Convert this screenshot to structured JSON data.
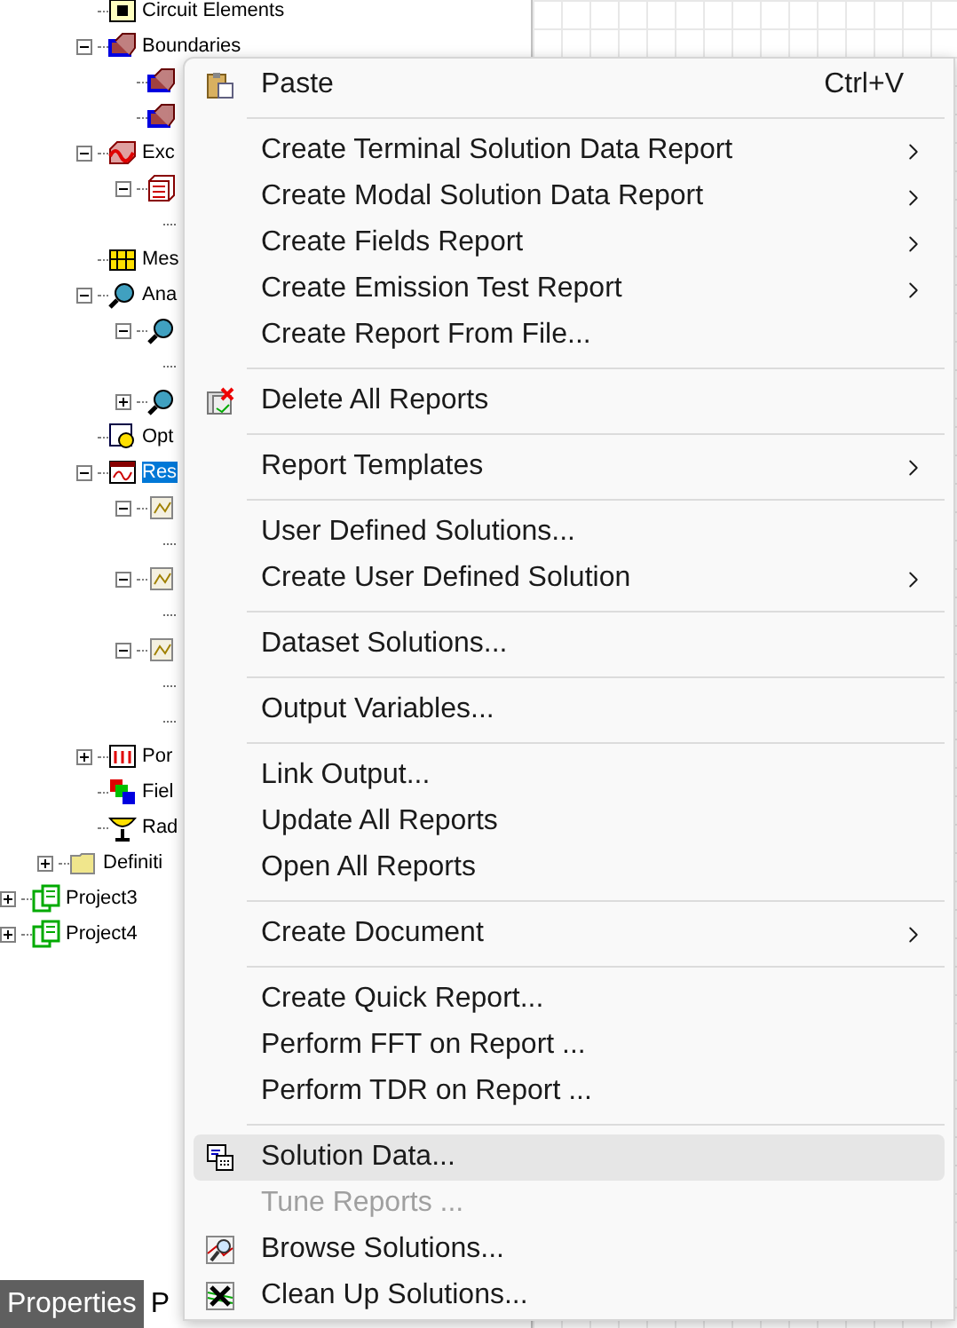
{
  "tree": [
    {
      "label": "Circuit Elements",
      "kind": "circuit"
    },
    {
      "label": "Boundaries",
      "kind": "boundary",
      "expanded": true,
      "children": [
        {
          "kind": "boundary"
        },
        {
          "kind": "boundary"
        }
      ]
    },
    {
      "label": "Exc",
      "kind": "excitation",
      "expanded": true,
      "children": [
        {
          "kind": "port",
          "expanded": true,
          "children": [
            {
              "kind": "connector"
            }
          ]
        }
      ]
    },
    {
      "label": "Mes",
      "kind": "mesh"
    },
    {
      "label": "Ana",
      "kind": "analysis",
      "expanded": true,
      "children": [
        {
          "kind": "analysis",
          "expanded": true,
          "children": [
            {
              "kind": "connector"
            }
          ]
        },
        {
          "kind": "analysis",
          "expanded": false
        }
      ]
    },
    {
      "label": "Opt",
      "kind": "optimetrics"
    },
    {
      "label": "Res",
      "kind": "results",
      "selected": true,
      "expanded": true,
      "children": [
        {
          "kind": "report",
          "expanded": true,
          "children": [
            {
              "kind": "connector"
            }
          ]
        },
        {
          "kind": "report",
          "expanded": true,
          "children": [
            {
              "kind": "connector"
            }
          ]
        },
        {
          "kind": "report",
          "expanded": true,
          "children": [
            {
              "kind": "connector"
            },
            {
              "kind": "connector"
            }
          ]
        }
      ]
    },
    {
      "label": "Por",
      "kind": "portfield",
      "expanded": false
    },
    {
      "label": "Fiel",
      "kind": "fields"
    },
    {
      "label": "Rad",
      "kind": "radiation"
    }
  ],
  "definitions": {
    "label": "Definiti",
    "kind": "folder",
    "expanded": false
  },
  "projects": [
    {
      "label": "Project3",
      "kind": "project",
      "expanded": false
    },
    {
      "label": "Project4",
      "kind": "project",
      "expanded": false
    }
  ],
  "bottom_tabs": [
    {
      "label": "Properties",
      "selected": true
    },
    {
      "label": "P",
      "selected": false
    }
  ],
  "menu": [
    {
      "kind": "paste",
      "label": "Paste",
      "shortcut": "Ctrl+V"
    },
    {
      "kind": "separator"
    },
    {
      "kind": "item",
      "label": "Create Terminal Solution Data Report",
      "submenu": true
    },
    {
      "kind": "item",
      "label": "Create Modal Solution Data Report",
      "submenu": true
    },
    {
      "kind": "item",
      "label": "Create Fields Report",
      "submenu": true
    },
    {
      "kind": "item",
      "label": "Create Emission Test Report",
      "submenu": true
    },
    {
      "kind": "item",
      "label": "Create Report From File..."
    },
    {
      "kind": "separator"
    },
    {
      "kind": "delete",
      "label": "Delete All Reports"
    },
    {
      "kind": "separator"
    },
    {
      "kind": "item",
      "label": "Report Templates",
      "submenu": true
    },
    {
      "kind": "separator"
    },
    {
      "kind": "item",
      "label": "User Defined Solutions..."
    },
    {
      "kind": "item",
      "label": "Create User Defined Solution",
      "submenu": true
    },
    {
      "kind": "separator"
    },
    {
      "kind": "item",
      "label": "Dataset Solutions..."
    },
    {
      "kind": "separator"
    },
    {
      "kind": "item",
      "label": "Output Variables..."
    },
    {
      "kind": "separator"
    },
    {
      "kind": "item",
      "label": "Link Output..."
    },
    {
      "kind": "item",
      "label": "Update All Reports"
    },
    {
      "kind": "item",
      "label": "Open All Reports"
    },
    {
      "kind": "separator"
    },
    {
      "kind": "item",
      "label": "Create Document",
      "submenu": true
    },
    {
      "kind": "separator"
    },
    {
      "kind": "item",
      "label": "Create Quick Report..."
    },
    {
      "kind": "item",
      "label": "Perform FFT on Report ..."
    },
    {
      "kind": "item",
      "label": "Perform TDR on Report ..."
    },
    {
      "kind": "separator"
    },
    {
      "kind": "solution",
      "label": "Solution Data...",
      "selected": true
    },
    {
      "kind": "item",
      "label": "Tune Reports ...",
      "disabled": true
    },
    {
      "kind": "browse",
      "label": "Browse Solutions..."
    },
    {
      "kind": "cleanup",
      "label": "Clean Up Solutions..."
    }
  ]
}
